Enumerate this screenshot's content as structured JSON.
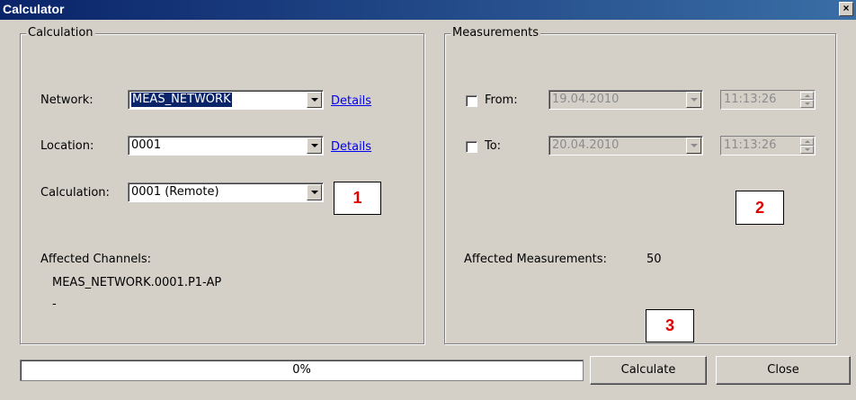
{
  "window": {
    "title": "Calculator",
    "close_glyph": "×"
  },
  "calculation": {
    "group_label": "Calculation",
    "network": {
      "label": "Network:",
      "value": "MEAS_NETWORK",
      "details": "Details"
    },
    "location": {
      "label": "Location:",
      "value": "0001",
      "details": "Details"
    },
    "calc": {
      "label": "Calculation:",
      "value": "0001 (Remote)"
    },
    "affected_label": "Affected Channels:",
    "channels": [
      "MEAS_NETWORK.0001.P1-AP",
      "-"
    ]
  },
  "measurements": {
    "group_label": "Measurements",
    "from": {
      "label": "From:",
      "date": "19.04.2010",
      "time": "11:13:26",
      "checked": false
    },
    "to": {
      "label": "To:",
      "date": "20.04.2010",
      "time": "11:13:26",
      "checked": false
    },
    "affected_label": "Affected Measurements:",
    "affected_count": "50"
  },
  "annotations": [
    "1",
    "2",
    "3"
  ],
  "footer": {
    "progress": {
      "text": "0%",
      "value": 0
    },
    "calculate_label": "Calculate",
    "close_label": "Close"
  }
}
